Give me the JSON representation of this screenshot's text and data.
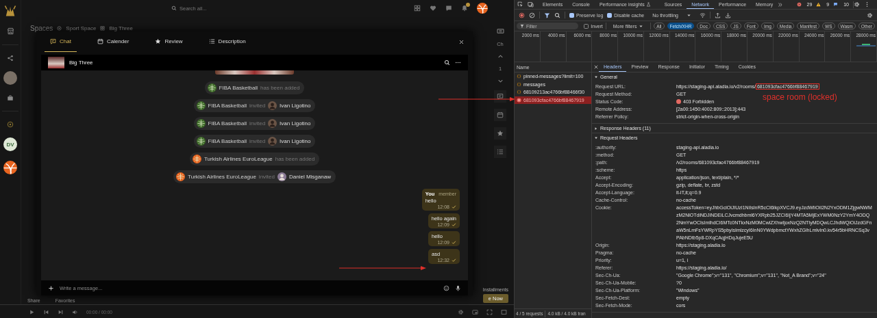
{
  "app": {
    "search": {
      "placeholder": "Search all..."
    },
    "sidebar": {
      "badge": "DV"
    },
    "breadcrumb": [
      "Spaces",
      "Sport Space",
      "Big Three"
    ],
    "rail": {
      "label": "Ch",
      "count": "1"
    },
    "promo": {
      "text": "Installments",
      "button": "e Now"
    },
    "actions": [
      "Share",
      "Favorites"
    ],
    "player": {
      "time": "00:00 / 00:00"
    }
  },
  "chat_modal": {
    "tabs": [
      {
        "label": "Chat",
        "selected": true
      },
      {
        "label": "Calender",
        "selected": false
      },
      {
        "label": "Review",
        "selected": false
      },
      {
        "label": "Description",
        "selected": false
      }
    ],
    "room": {
      "name": "Big Three"
    },
    "events": [
      {
        "kind": "added",
        "actor": "FIBA Basketball",
        "color": "#3f6b2a",
        "verb": "has been added"
      },
      {
        "kind": "invited",
        "actor": "FIBA Basketball",
        "color": "#3f6b2a",
        "verb": "invited",
        "target": "Ivan Ligotino"
      },
      {
        "kind": "invited",
        "actor": "FIBA Basketball",
        "color": "#3f6b2a",
        "verb": "invited",
        "target": "Ivan Ligotino"
      },
      {
        "kind": "invited",
        "actor": "FIBA Basketball",
        "color": "#3f6b2a",
        "verb": "invited",
        "target": "Ivan Ligotino"
      },
      {
        "kind": "added",
        "actor": "Turkish Airlines EuroLeague",
        "color": "#e8641f",
        "verb": "has been added"
      },
      {
        "kind": "invited",
        "actor": "Turkish Airlines EuroLeague",
        "color": "#e8641f",
        "verb": "invited",
        "target": "Daniel Misganaw"
      }
    ],
    "messages": [
      {
        "author": "You",
        "role": "member",
        "text": "hello",
        "time": "12:08",
        "delivered": true
      },
      {
        "text": "hello again",
        "time": "12:09",
        "delivered": true
      },
      {
        "text": "hello",
        "time": "12:09",
        "delivered": true
      },
      {
        "text": "asd",
        "time": "12:32",
        "delivered": true
      }
    ],
    "composer": {
      "placeholder": "Write a message..."
    }
  },
  "annotation": {
    "label": "space room (locked)"
  },
  "devtools": {
    "tabs": [
      {
        "label": "Elements",
        "selected": false
      },
      {
        "label": "Console",
        "selected": false
      },
      {
        "label": "Performance insights",
        "selected": false
      },
      {
        "label": "Sources",
        "selected": false
      },
      {
        "label": "Network",
        "selected": true
      },
      {
        "label": "Performance",
        "selected": false
      },
      {
        "label": "Memory",
        "selected": false
      }
    ],
    "counts": {
      "errors": "29",
      "warnings": "9",
      "messages": "10"
    },
    "options": [
      {
        "label": "Preserve log",
        "checked": true
      },
      {
        "label": "Disable cache",
        "checked": true
      }
    ],
    "throttling": "No throttling",
    "filter": {
      "placeholder": "Filter",
      "invert": {
        "label": "Invert",
        "checked": false
      },
      "more": "More filters"
    },
    "types": [
      {
        "label": "All",
        "selected": false
      },
      {
        "label": "Fetch/XHR",
        "selected": true
      },
      {
        "label": "Doc",
        "selected": false
      },
      {
        "label": "CSS",
        "selected": false
      },
      {
        "label": "JS",
        "selected": false
      },
      {
        "label": "Font",
        "selected": false
      },
      {
        "label": "Img",
        "selected": false
      },
      {
        "label": "Media",
        "selected": false
      },
      {
        "label": "Manifest",
        "selected": false
      },
      {
        "label": "WS",
        "selected": false
      },
      {
        "label": "Wasm",
        "selected": false
      },
      {
        "label": "Other",
        "selected": false
      }
    ],
    "ticks": [
      "2000 ms",
      "4000 ms",
      "6000 ms",
      "8000 ms",
      "10000 ms",
      "12000 ms",
      "14000 ms",
      "16000 ms",
      "18000 ms",
      "20000 ms",
      "22000 ms",
      "24000 ms",
      "26000 ms",
      "28000 ms"
    ],
    "requests": {
      "header": "Name",
      "rows": [
        {
          "name": "pinned-messages?limit=100",
          "failed": false,
          "selected": false
        },
        {
          "name": "messages",
          "failed": false,
          "selected": false
        },
        {
          "name": "68109213ac4766bf88466f30",
          "failed": false,
          "selected": false
        },
        {
          "name": "681093cfac4766bf88467919",
          "failed": true,
          "selected": true
        }
      ]
    },
    "summary": [
      "4 / 5 requests",
      "4.0 kB / 4.0 kB tran"
    ],
    "detail_tabs": [
      {
        "label": "Headers",
        "selected": true
      },
      {
        "label": "Preview",
        "selected": false
      },
      {
        "label": "Response",
        "selected": false
      },
      {
        "label": "Initiator",
        "selected": false
      },
      {
        "label": "Timing",
        "selected": false
      },
      {
        "label": "Cookies",
        "selected": false
      }
    ],
    "sections": [
      {
        "title": "General",
        "expanded": true,
        "rows": [
          {
            "name": "Request URL:",
            "value": "https://staging-api.aladia.io/v2/rooms/",
            "boxed": "681093cfac4766bf88467919"
          },
          {
            "name": "Request Method:",
            "value": "GET"
          },
          {
            "name": "Status Code:",
            "value": "403 Forbidden",
            "kind": "status",
            "status_ok": false
          },
          {
            "name": "Remote Address:",
            "value": "[2a00:1450:4002:809::2013]:443"
          },
          {
            "name": "Referrer Policy:",
            "value": "strict-origin-when-cross-origin"
          }
        ]
      },
      {
        "title": "Response Headers (11)",
        "expanded": false
      },
      {
        "title": "Request Headers",
        "expanded": true,
        "rows": [
          {
            "name": ":authority:",
            "value": "staging-api.aladia.io"
          },
          {
            "name": ":method:",
            "value": "GET"
          },
          {
            "name": ":path:",
            "value": "/v2/rooms/681093cfac4766bf88467919"
          },
          {
            "name": ":scheme:",
            "value": "https"
          },
          {
            "name": "Accept:",
            "value": "application/json, text/plain, */*"
          },
          {
            "name": "Accept-Encoding:",
            "value": "gzip, deflate, br, zstd"
          },
          {
            "name": "Accept-Language:",
            "value": "it-IT,it;q=0.9"
          },
          {
            "name": "Cache-Control:",
            "value": "no-cache"
          },
          {
            "name": "Cookie:",
            "value": "accessToken=eyJhbGciOiJIUzI1NiIsInR5cCI6IkpXVCJ9.eyJzdWIiOiI2N2YxODM1ZjgwNWMzM2NlOTdiNDJlNDEiLCJvcmdhbml6YXRpb25JZCI6IjY4MTA5MjExYWM0NzY2YmY4ODQ2NmYwOCIsImlhdCI6MTc0NTkxNzM0MCwiZXhwIjoxNzQ2NTIyMDQwLCJhdWQiOiJzdGFnaW5nLmFsYWRpYS5pbyIsImlzcyI6InN0YWdpbmctYWxhZGlhLmlvIn0.kv54r5bHRNCSq3vPAbNDtb5p8-DXqCAqjHDqJujeE5U"
          },
          {
            "name": "Origin:",
            "value": "https://staging.aladia.io"
          },
          {
            "name": "Pragma:",
            "value": "no-cache"
          },
          {
            "name": "Priority:",
            "value": "u=1, i"
          },
          {
            "name": "Referer:",
            "value": "https://staging.aladia.io/"
          },
          {
            "name": "Sec-Ch-Ua:",
            "value": "\"Google Chrome\";v=\"131\", \"Chromium\";v=\"131\", \"Not_A Brand\";v=\"24\""
          },
          {
            "name": "Sec-Ch-Ua-Mobile:",
            "value": "?0"
          },
          {
            "name": "Sec-Ch-Ua-Platform:",
            "value": "\"Windows\""
          },
          {
            "name": "Sec-Fetch-Dest:",
            "value": "empty"
          },
          {
            "name": "Sec-Fetch-Mode:",
            "value": "cors"
          }
        ]
      }
    ]
  }
}
